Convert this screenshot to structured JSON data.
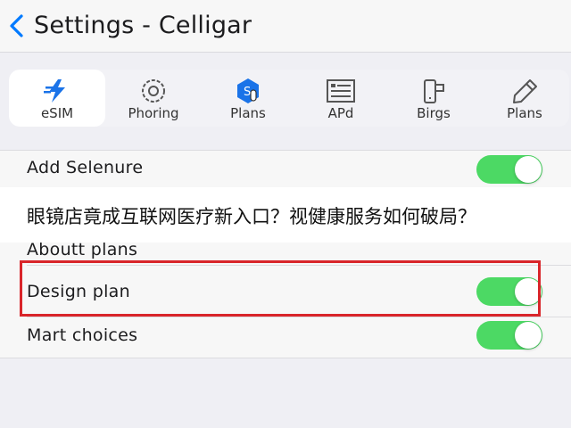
{
  "header": {
    "title": "Settings - Celligar",
    "back_icon": "chevron-left-icon",
    "accent_color": "#007aff"
  },
  "tabs": [
    {
      "label": "eSIM",
      "icon": "esim-icon",
      "active": true
    },
    {
      "label": "Phoring",
      "icon": "circle-phone-icon",
      "active": false
    },
    {
      "label": "Plans",
      "icon": "plans-tap-icon",
      "active": false
    },
    {
      "label": "APd",
      "icon": "document-list-icon",
      "active": false
    },
    {
      "label": "Birgs",
      "icon": "device-icon",
      "active": false
    },
    {
      "label": "Plans",
      "icon": "pencil-icon",
      "active": false
    }
  ],
  "settings": {
    "add_selenure": {
      "label": "Add Selenure",
      "toggle_on": true
    },
    "aboutt_plans": {
      "label": "Aboutt plans"
    },
    "design_plan": {
      "label": "Design plan",
      "toggle_on": true
    },
    "mart_choices": {
      "label": "Mart choices",
      "toggle_on": true
    }
  },
  "banner": {
    "text": "眼镜店竟成互联网医疗新入口？视健康服务如何破局？"
  },
  "colors": {
    "toggle_on": "#4cd964",
    "highlight": "#d9252a"
  }
}
